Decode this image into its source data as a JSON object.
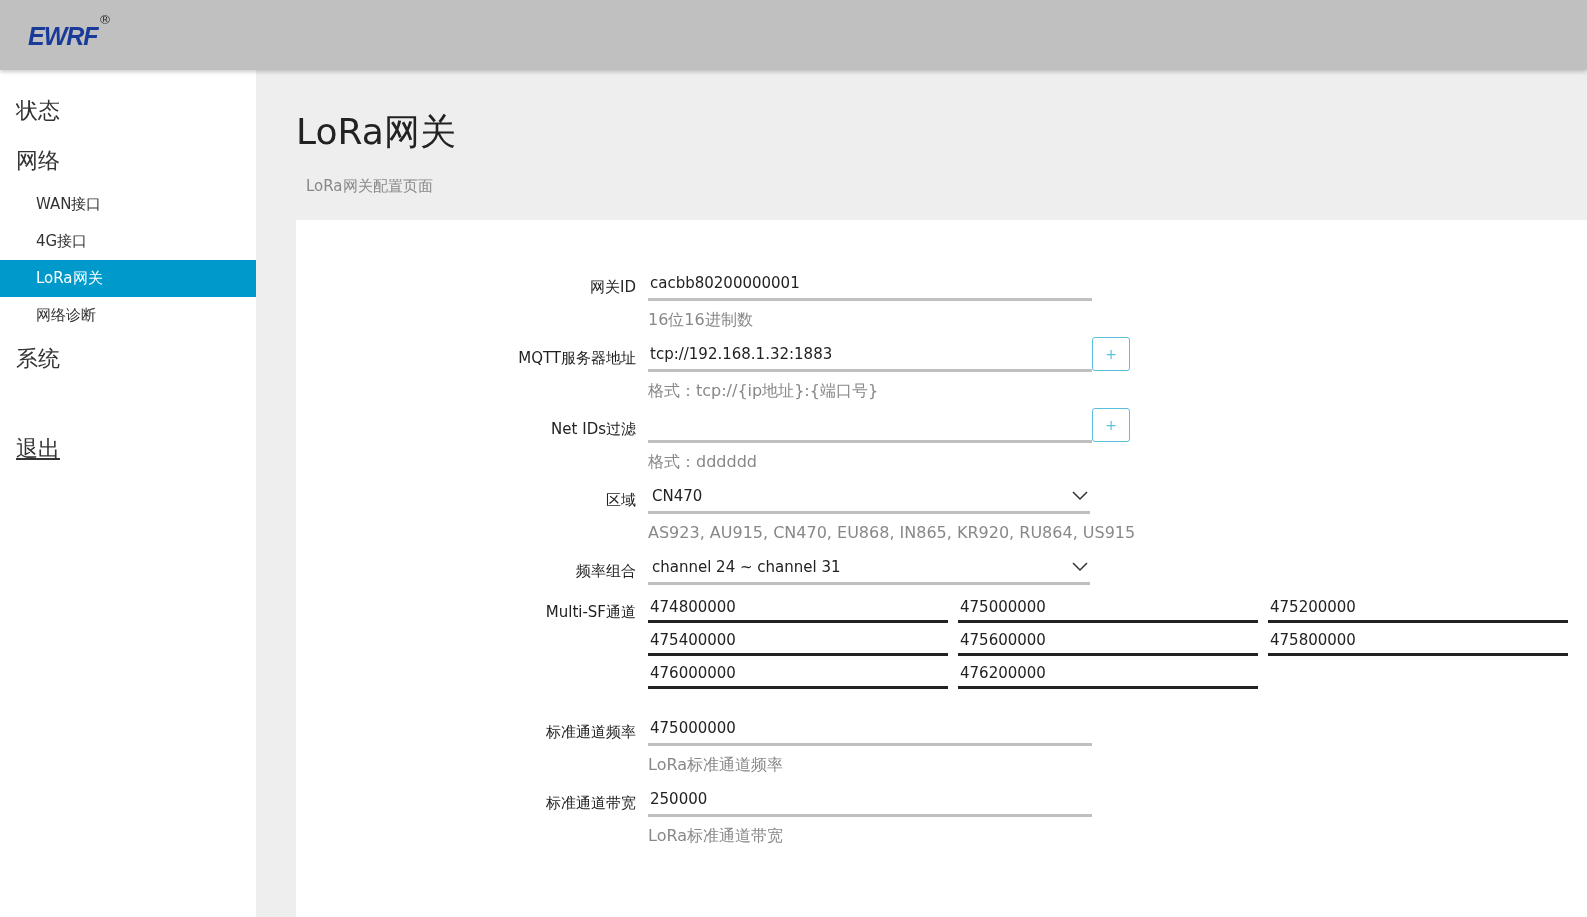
{
  "header": {
    "logo": "EWRF",
    "registered_mark": "®"
  },
  "sidebar": {
    "items": [
      {
        "label": "状态",
        "kind": "section",
        "selected": false
      },
      {
        "label": "网络",
        "kind": "section",
        "selected": false,
        "children": [
          {
            "label": "WAN接口",
            "selected": false
          },
          {
            "label": "4G接口",
            "selected": false
          },
          {
            "label": "LoRa网关",
            "selected": true
          },
          {
            "label": "网络诊断",
            "selected": false
          }
        ]
      },
      {
        "label": "系统",
        "kind": "section",
        "selected": false
      },
      {
        "label": "退出",
        "kind": "logout",
        "selected": false
      }
    ]
  },
  "page": {
    "title": "LoRa网关",
    "subtitle": "LoRa网关配置页面"
  },
  "form": {
    "fields": [
      {
        "kind": "text",
        "label": "网关ID",
        "value": "cacbb80200000001",
        "hint": "16位16进制数"
      },
      {
        "kind": "text",
        "label": "MQTT服务器地址",
        "value": "tcp://192.168.1.32:1883",
        "add_button": "+",
        "hint": "格式：tcp://{ip地址}:{端口号}"
      },
      {
        "kind": "text",
        "label": "Net IDs过滤",
        "add_button": "+",
        "hint": "格式：dddddd"
      },
      {
        "kind": "select",
        "label": "区域",
        "value": "CN470",
        "hint": "AS923, AU915, CN470, EU868, IN865, KR920, RU864, US915"
      },
      {
        "kind": "select",
        "label": "频率组合",
        "value": "channel 24 ~ channel 31"
      },
      {
        "kind": "multi",
        "label": "Multi-SF通道",
        "values": [
          "474800000",
          "475000000",
          "475200000",
          "475400000",
          "475600000",
          "475800000",
          "476000000",
          "476200000"
        ]
      },
      {
        "kind": "text",
        "label": "标准通道频率",
        "value": "475000000",
        "hint": "LoRa标准通道频率"
      },
      {
        "kind": "text",
        "label": "标准通道带宽",
        "value": "250000",
        "hint": "LoRa标准通道带宽"
      }
    ]
  }
}
